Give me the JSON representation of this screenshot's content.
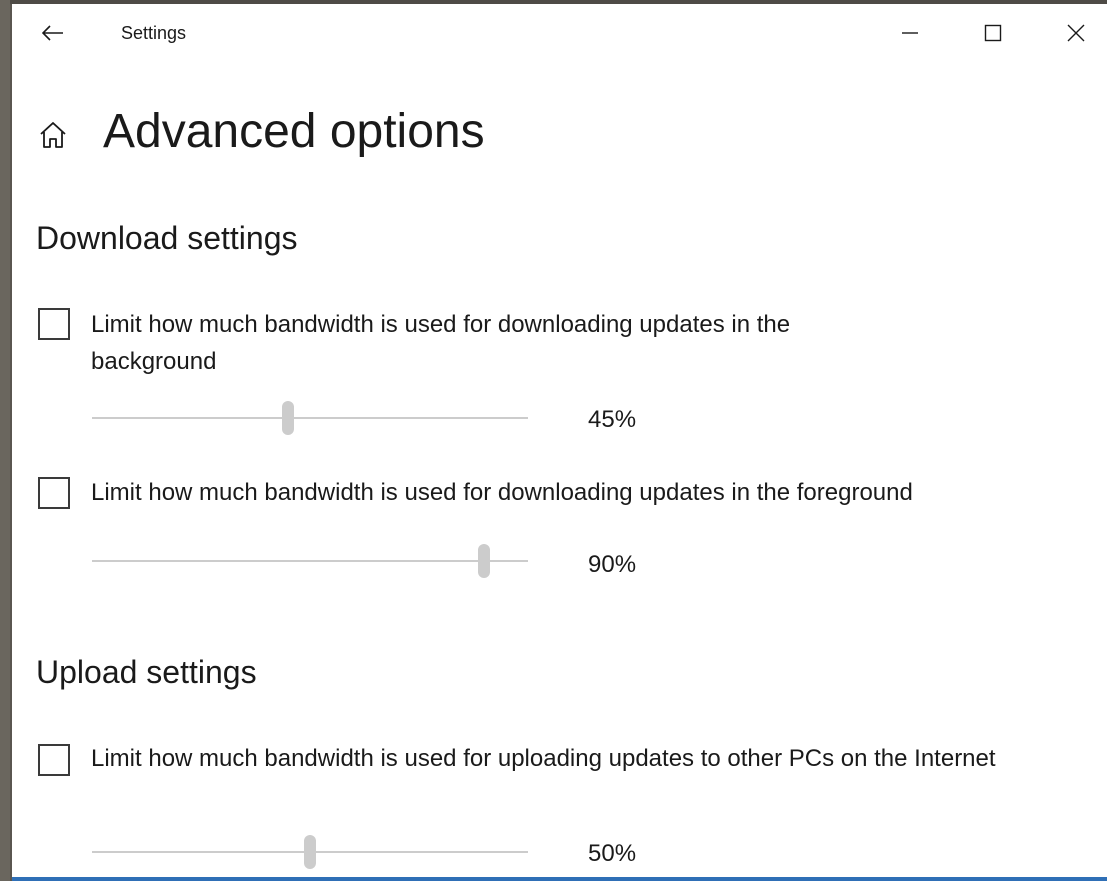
{
  "window": {
    "app_title": "Settings",
    "back_icon": "arrow-left-icon",
    "minimize_icon": "minimize-icon",
    "maximize_icon": "maximize-icon",
    "close_icon": "close-icon"
  },
  "page": {
    "home_icon": "home-icon",
    "title": "Advanced options"
  },
  "download": {
    "heading": "Download settings",
    "background": {
      "label": "Limit how much bandwidth is used for downloading updates in the background",
      "checked": false,
      "slider_fraction": 0.45,
      "value_label": "45%"
    },
    "foreground": {
      "label": "Limit how much bandwidth is used for downloading updates in the foreground",
      "checked": false,
      "slider_fraction": 0.9,
      "value_label": "90%"
    }
  },
  "upload": {
    "heading": "Upload settings",
    "internet": {
      "label": "Limit how much bandwidth is used for uploading updates to other PCs on the Internet",
      "checked": false,
      "slider_fraction": 0.5,
      "value_label": "50%"
    }
  },
  "colors": {
    "window_bg": "#ffffff",
    "slider_disabled": "#cccccc",
    "checkbox_border": "#3a3a3a",
    "accent_strip": "#2f6fb6"
  }
}
